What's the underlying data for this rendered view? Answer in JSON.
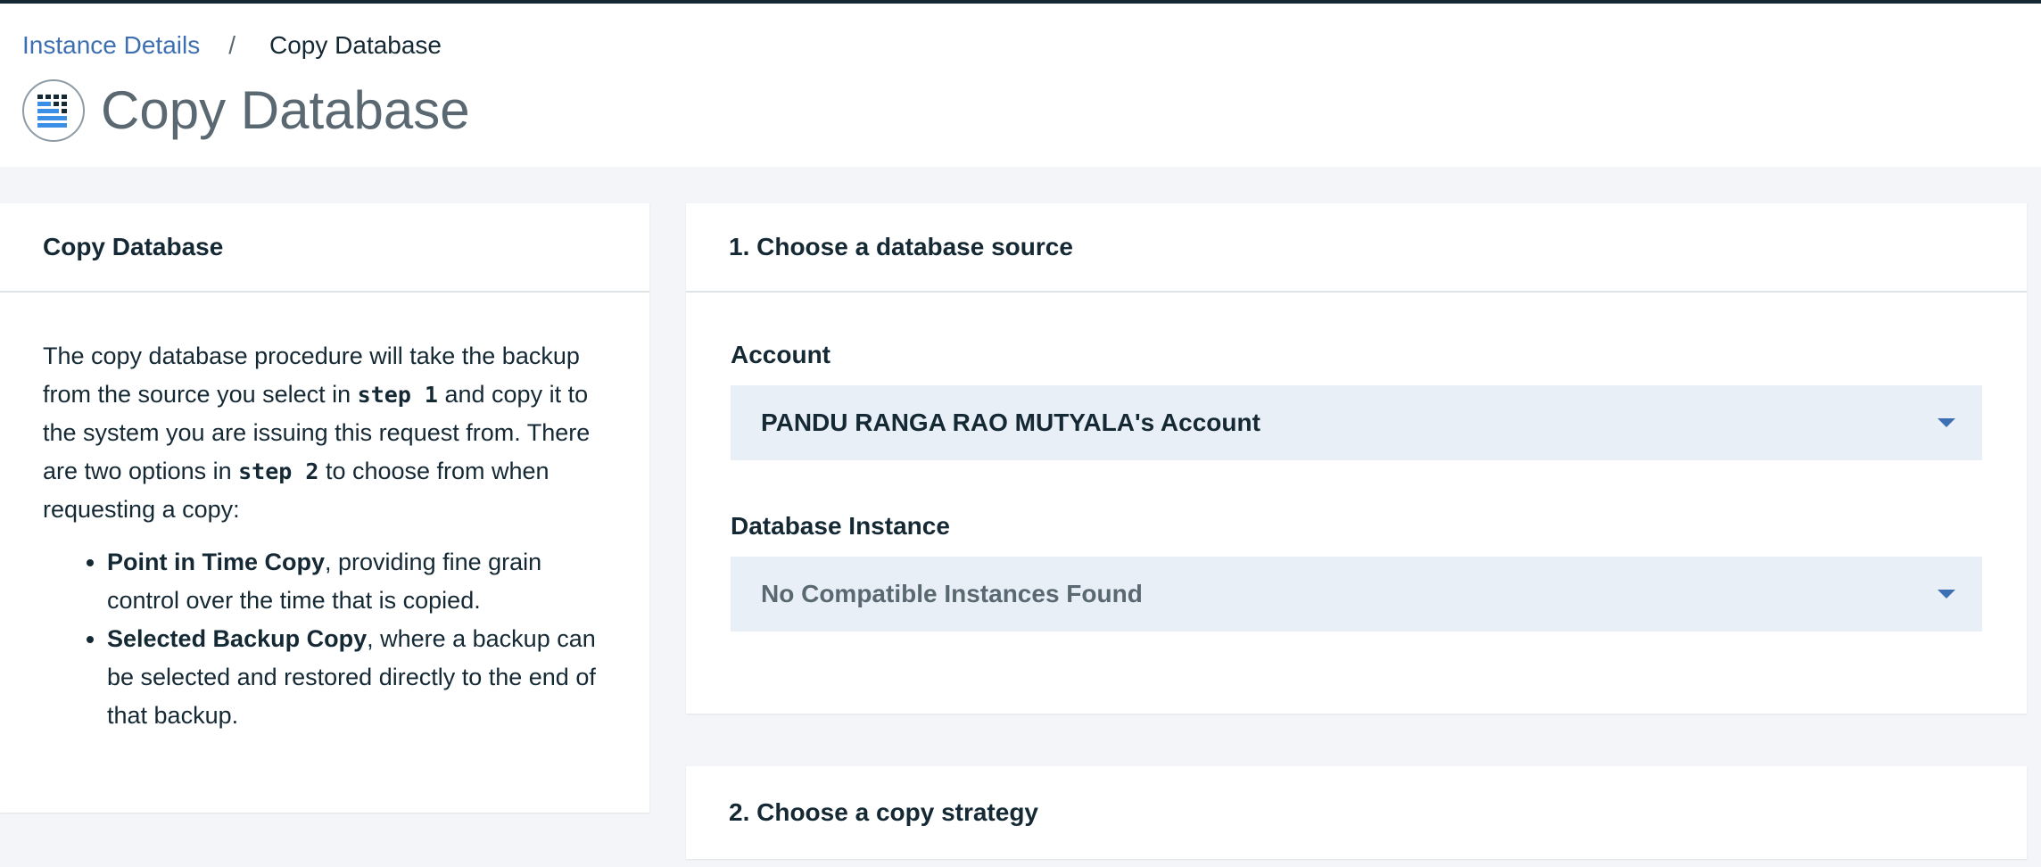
{
  "breadcrumb": {
    "parent": "Instance Details",
    "separator": "/",
    "current": "Copy Database"
  },
  "header": {
    "title": "Copy Database",
    "icon": "database-icon"
  },
  "info_panel": {
    "title": "Copy Database",
    "p1_a": "The copy database procedure will take the backup from the source you select in ",
    "p1_b": "step 1",
    "p1_c": " and copy it to the system you are issuing this request from. There are two options in ",
    "p1_d": "step 2",
    "p1_e": " to choose from when requesting a copy:",
    "options": [
      {
        "name": "Point in Time Copy",
        "desc": ", providing fine grain control over the time that is copied."
      },
      {
        "name": "Selected Backup Copy",
        "desc": ", where a backup can be selected and restored directly to the end of that backup."
      }
    ]
  },
  "step1": {
    "title": "1. Choose a database source",
    "account_label": "Account",
    "account_value": "PANDU RANGA RAO MUTYALA's Account",
    "instance_label": "Database Instance",
    "instance_value": "No Compatible Instances Found"
  },
  "step2": {
    "title": "2. Choose a copy strategy"
  },
  "colors": {
    "accent": "#3d70b2",
    "top_bar": "#152935",
    "select_bg": "#e9eff6",
    "icon_blue": "#3a8ee6"
  }
}
